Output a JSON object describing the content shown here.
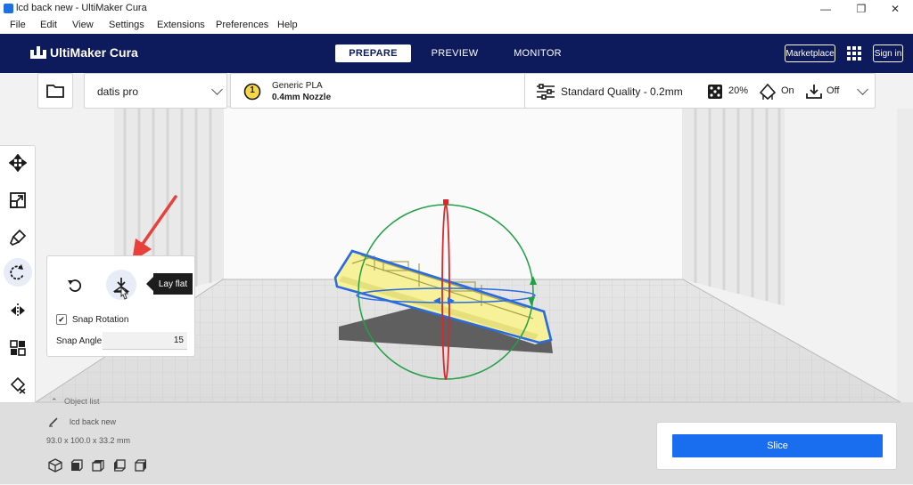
{
  "window": {
    "title": "lcd back new - UltiMaker Cura",
    "controls": {
      "minimize": "—",
      "maximize": "❐",
      "close": "✕"
    }
  },
  "menu": [
    "File",
    "Edit",
    "View",
    "Settings",
    "Extensions",
    "Preferences",
    "Help"
  ],
  "header": {
    "logo_text": "UltiMaker Cura",
    "tabs": [
      "PREPARE",
      "PREVIEW",
      "MONITOR"
    ],
    "active_tab": "PREPARE",
    "marketplace_label": "Marketplace",
    "signin_label": "Sign in"
  },
  "config": {
    "printer_name": "datis pro",
    "extruder_number": "1",
    "material": "Generic PLA",
    "nozzle": "0.4mm Nozzle",
    "quality": "Standard Quality - 0.2mm",
    "infill": "20%",
    "support": "On",
    "adhesion": "Off"
  },
  "rotate_panel": {
    "tooltip": "Lay flat",
    "snap_rotation_label": "Snap Rotation",
    "snap_rotation_checked": true,
    "snap_angle_label": "Snap Angle",
    "snap_angle_value": "15"
  },
  "object_list": {
    "header": "Object list",
    "object_name": "lcd back new",
    "dimensions": "93.0 x 100.0 x 33.2 mm"
  },
  "slice": {
    "label": "Slice"
  },
  "colors": {
    "header_bg": "#0d1a5c",
    "accent_blue": "#196ef0",
    "model_yellow": "#f7f29a",
    "selection_outline": "#2a6be0",
    "rotate_ring_green": "#22a046",
    "rotate_ring_red": "#d8282c",
    "annotation_arrow": "#e8403a"
  }
}
